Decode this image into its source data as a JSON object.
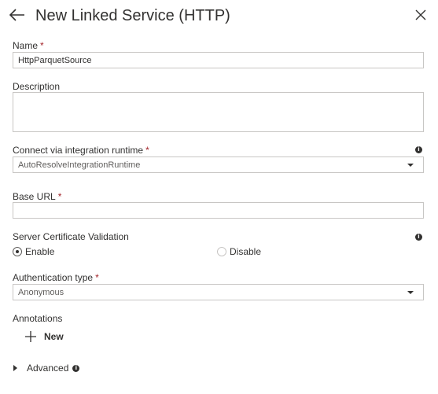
{
  "header": {
    "title": "New Linked Service (HTTP)",
    "back_icon": "arrow-left-icon",
    "close_icon": "close-icon"
  },
  "required_marker": "*",
  "fields": {
    "name": {
      "label": "Name",
      "value": "HttpParquetSource"
    },
    "description": {
      "label": "Description",
      "value": ""
    },
    "runtime": {
      "label": "Connect via integration runtime",
      "value": "AutoResolveIntegrationRuntime",
      "info_icon": "info-icon"
    },
    "base_url": {
      "label": "Base URL",
      "value": ""
    },
    "cert_validation": {
      "label": "Server Certificate Validation",
      "options": [
        {
          "label": "Enable",
          "selected": true
        },
        {
          "label": "Disable",
          "selected": false
        }
      ],
      "info_icon": "info-icon"
    },
    "auth_type": {
      "label": "Authentication type",
      "value": "Anonymous"
    }
  },
  "annotations": {
    "label": "Annotations",
    "new_label": "New",
    "add_icon": "plus-icon"
  },
  "advanced": {
    "label": "Advanced",
    "expander_icon": "chevron-right-icon",
    "info_icon": "info-icon"
  },
  "colors": {
    "required": "#a4262c",
    "text": "#323130",
    "border": "#c8c6c4"
  }
}
